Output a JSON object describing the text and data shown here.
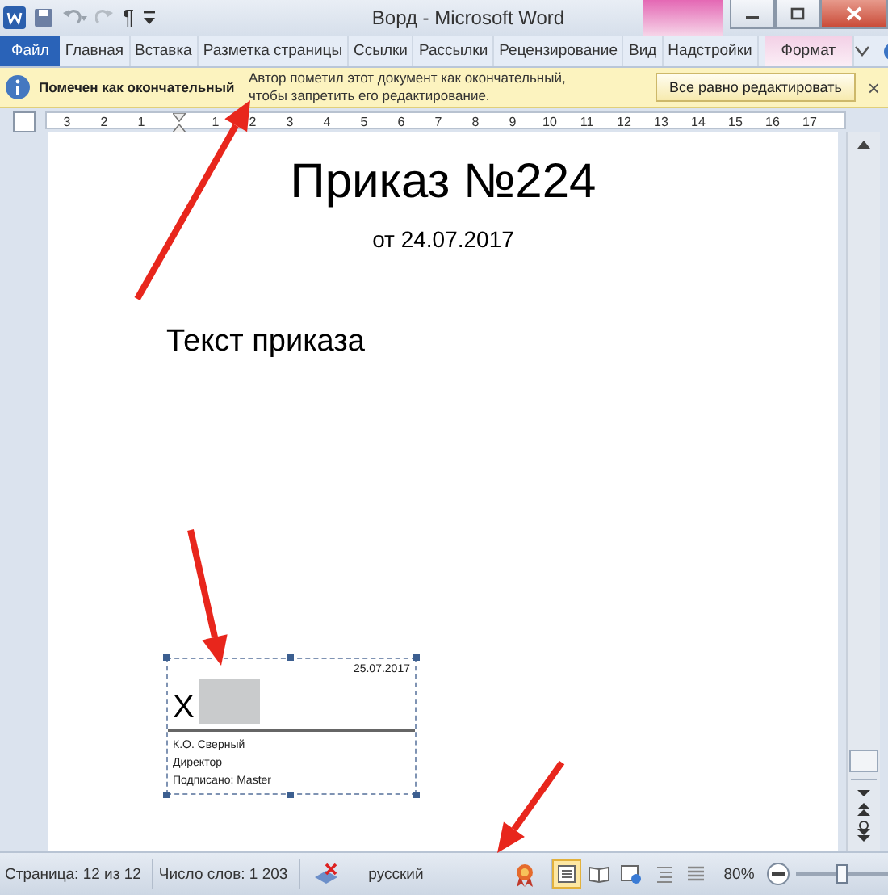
{
  "title_bar": {
    "title": "Ворд - Microsoft Word",
    "marks_button": "¶"
  },
  "ribbon_tabs": [
    {
      "label": "Файл",
      "kind": "file",
      "selected": false
    },
    {
      "label": "Главная",
      "kind": "tab",
      "selected": false
    },
    {
      "label": "Вставка",
      "kind": "tab",
      "selected": false
    },
    {
      "label": "Разметка страницы",
      "kind": "tab",
      "selected": false
    },
    {
      "label": "Ссылки",
      "kind": "tab",
      "selected": false
    },
    {
      "label": "Рассылки",
      "kind": "tab",
      "selected": false
    },
    {
      "label": "Рецензирование",
      "kind": "tab",
      "selected": false
    },
    {
      "label": "Вид",
      "kind": "tab",
      "selected": false
    },
    {
      "label": "Надстройки",
      "kind": "tab",
      "selected": false
    },
    {
      "label": "Формат",
      "kind": "contextual",
      "selected": false
    }
  ],
  "info_bar": {
    "title": "Помечен как окончательный",
    "message_lines": [
      "Автор пометил этот документ как окончательный,",
      "чтобы запретить его редактирование."
    ],
    "button": "Все равно редактировать",
    "close": "×"
  },
  "ruler": {
    "left_marks": [
      "3",
      "2",
      "1"
    ],
    "marks": [
      "1",
      "2",
      "3",
      "4",
      "5",
      "6",
      "7",
      "8",
      "9",
      "10",
      "11",
      "12",
      "13",
      "14",
      "15",
      "16",
      "17"
    ]
  },
  "document": {
    "heading": "Приказ №224",
    "date": "от 24.07.2017",
    "body": "Текст приказа",
    "signature": {
      "date": "25.07.2017",
      "mark": "X",
      "lines": [
        "К.О. Сверный",
        "Директор",
        "Подписано: Master"
      ]
    }
  },
  "status_bar": {
    "page": "Страница: 12 из 12",
    "words": "Число слов: 1 203",
    "language": "русский",
    "views": [
      {
        "kind": "print",
        "selected": true
      },
      {
        "kind": "reading",
        "selected": false
      },
      {
        "kind": "web",
        "selected": false
      },
      {
        "kind": "outline",
        "selected": false
      },
      {
        "kind": "draft",
        "selected": false
      }
    ],
    "zoom": "80%",
    "zoom_slider": {
      "level": 0.42
    }
  }
}
